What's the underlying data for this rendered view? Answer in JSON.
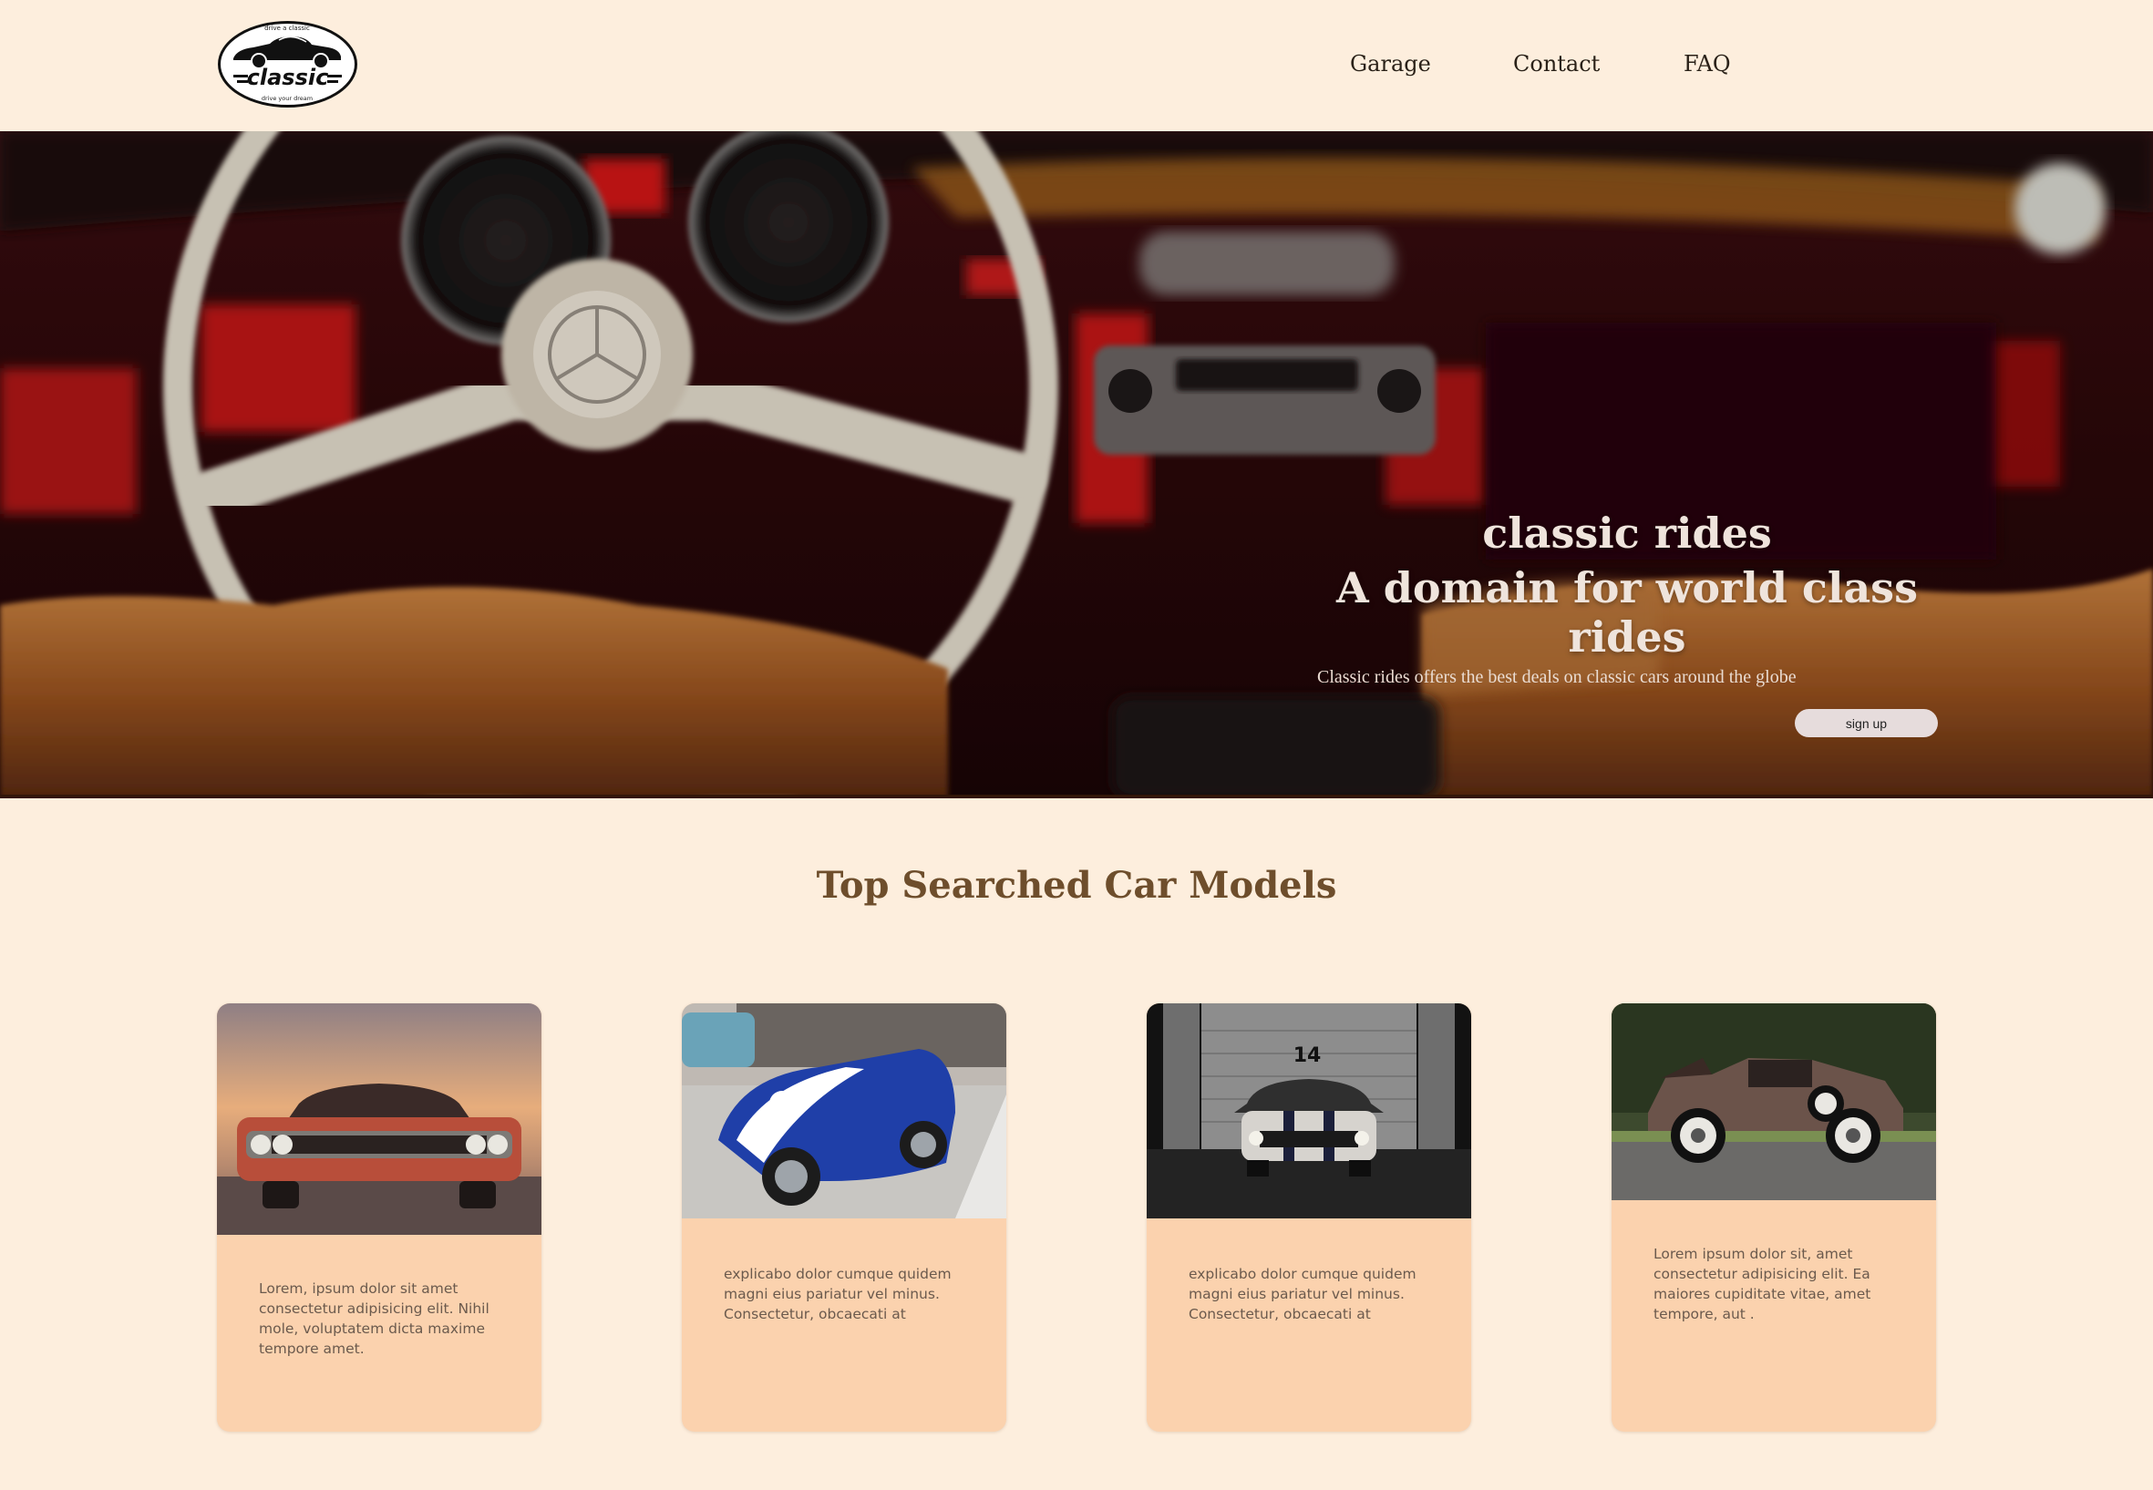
{
  "logo": {
    "top_text": "drive a classic",
    "wordmark": "classic",
    "bottom_text": "drive your dream"
  },
  "nav": {
    "items": [
      {
        "label": "Garage"
      },
      {
        "label": "Contact"
      },
      {
        "label": "FAQ"
      }
    ]
  },
  "hero": {
    "title_line1": "classic rides",
    "title_line2": "A domain for world class rides",
    "description": "Classic rides offers the best deals on classic cars around the globe",
    "cta_label": "sign up",
    "image": "blurred-classic-car-interior"
  },
  "models": {
    "heading": "Top Searched Car Models",
    "cards": [
      {
        "image": "red-muscle-car-at-sunset",
        "text": "Lorem, ipsum dolor sit amet consectetur adipisicing elit. Nihil mole, voluptatem dicta maxime tempore amet."
      },
      {
        "image": "blue-roadster-with-white-stripes",
        "text": "explicabo dolor cumque quidem magni eius pariatur vel minus. Consectetur, obcaecati at"
      },
      {
        "image": "silver-mustang-in-garage",
        "garage_number": "14",
        "text": "explicabo dolor cumque quidem magni eius pariatur vel minus. Consectetur, obcaecati at"
      },
      {
        "image": "vintage-brown-convertible",
        "text": "Lorem ipsum dolor sit, amet consectetur adipisicing elit. Ea maiores cupiditate vitae, amet tempore, aut ."
      }
    ]
  },
  "colors": {
    "page_background": "#fdeedd",
    "card_background": "#fbd2ae",
    "heading": "#6e4e2c"
  }
}
